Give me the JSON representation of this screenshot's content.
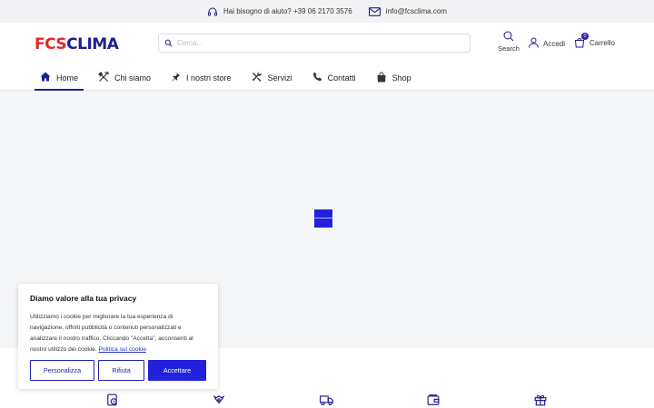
{
  "topbar": {
    "help_text": "Hai bisogno di aiuto? +39 06 2170 3576",
    "email": "info@fcsclima.com"
  },
  "logo": {
    "part1": "FCS",
    "part2": "CLIMA"
  },
  "search": {
    "placeholder": "Cerca..."
  },
  "header": {
    "search_label": "Search",
    "login_label": "Accedi",
    "cart_label": "Carrello",
    "cart_count": "0"
  },
  "nav": {
    "items": [
      {
        "label": "Home",
        "icon": "home-icon",
        "active": true
      },
      {
        "label": "Chi siamo",
        "icon": "tools-icon",
        "active": false
      },
      {
        "label": "I nostri store",
        "icon": "pin-icon",
        "active": false
      },
      {
        "label": "Servizi",
        "icon": "wrench-screwdriver-icon",
        "active": false
      },
      {
        "label": "Contatti",
        "icon": "phone-icon",
        "active": false
      },
      {
        "label": "Shop",
        "icon": "shopping-bag-icon",
        "active": false
      }
    ]
  },
  "cookie": {
    "title": "Diamo valore alla tua privacy",
    "body": "Utilizziamo i cookie per migliorare la tua esperienza di navigazione, offrirti pubblicità o contenuti personalizzati e analizzare il nostro traffico. Cliccando \"Accetta\", acconsenti al nostro utilizzo dei cookie.",
    "policy_link": "Politica sui cookie",
    "customize_label": "Personalizza",
    "reject_label": "Rifiuta",
    "accept_label": "Accettare"
  },
  "features": {
    "icons": [
      "tag-clock-icon",
      "handshake-icon",
      "delivery-truck-icon",
      "wallet-icon",
      "gift-icon"
    ]
  },
  "colors": {
    "brand_red": "#e0282c",
    "brand_navy": "#1e1e8c",
    "accent_blue": "#2222dd"
  }
}
